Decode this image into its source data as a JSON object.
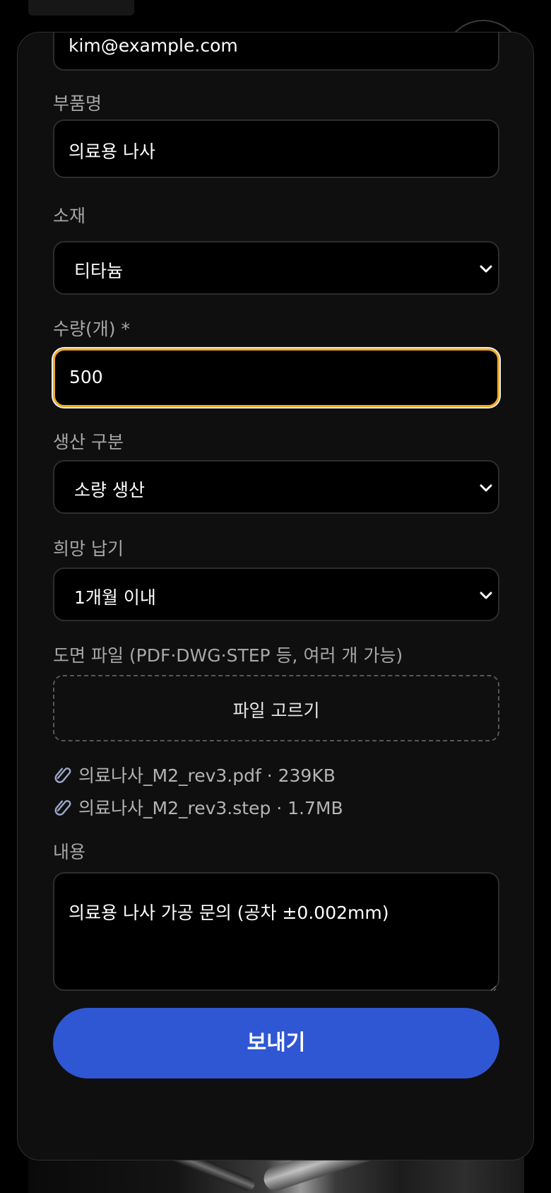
{
  "form": {
    "email": {
      "value": "kim@example.com"
    },
    "part_name": {
      "label": "부품명",
      "value": "의료용 나사"
    },
    "material": {
      "label": "소재",
      "value": "티타늄"
    },
    "quantity": {
      "label": "수량(개) *",
      "value": "500"
    },
    "production": {
      "label": "생산 구분",
      "value": "소량 생산"
    },
    "due": {
      "label": "희망 납기",
      "value": "1개월 이내"
    },
    "drawing": {
      "label": "도면 파일 (PDF·DWG·STEP 등, 여러 개 가능)",
      "pick_label": "파일 고르기",
      "files": [
        {
          "text": "의료나사_M2_rev3.pdf · 239KB",
          "icon": "paperclip-icon"
        },
        {
          "text": "의료나사_M2_rev3.step · 1.7MB",
          "icon": "paperclip-icon"
        }
      ]
    },
    "content": {
      "label": "내용",
      "value": "의료용 나사 가공 문의 (공차 ±0.002mm)"
    },
    "submit_label": "보내기"
  },
  "colors": {
    "accent": "#2f57d4",
    "focus_ring": "#f0a824",
    "sheet_bg": "#0f0f10",
    "field_bg": "#000000"
  }
}
